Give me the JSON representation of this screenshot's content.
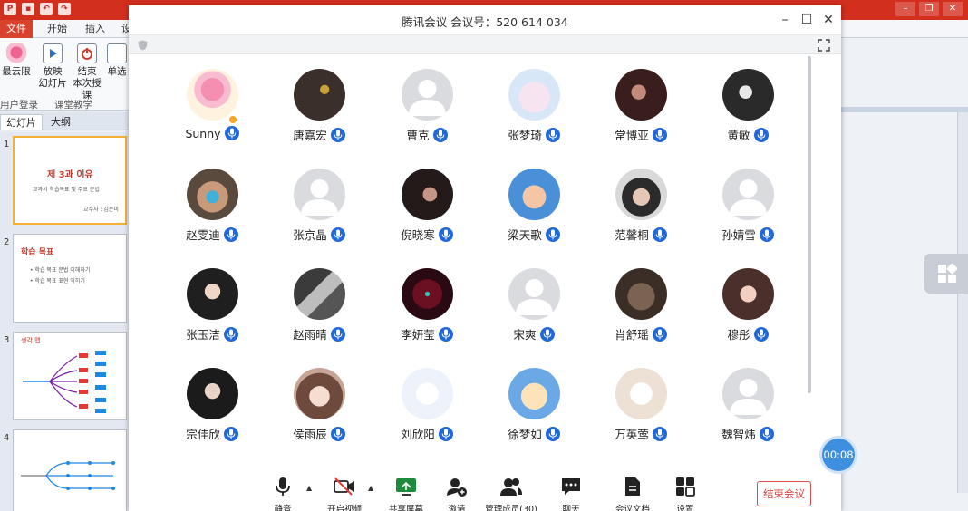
{
  "ppt": {
    "tabs": {
      "file": "文件",
      "home": "开始",
      "insert": "插入",
      "partial": "设"
    },
    "ribbon": {
      "btn1": "最云限",
      "btn2a": "放映",
      "btn2b": "幻灯片",
      "btn3a": "结束",
      "btn3b": "本次授课",
      "btn4": "单选",
      "group1": "用户登录",
      "group2": "课堂教学"
    },
    "side_tabs": {
      "slides": "幻灯片",
      "outline": "大纲"
    },
    "thumbs": [
      {
        "num": "1",
        "title": "제 3과 이유",
        "line1": "교과서 학습목표 및 주요 문법",
        "line2": "교수자 : 김은미"
      },
      {
        "num": "2",
        "title": "학습 목표",
        "line1": "• 학습 목표 문법 이해하기",
        "line2": "• 학습 목표 표현 익히기"
      },
      {
        "num": "3",
        "title": "생각 맵",
        "line1": "",
        "line2": ""
      },
      {
        "num": "4",
        "title": "",
        "line1": "",
        "line2": ""
      }
    ]
  },
  "meeting": {
    "title": "腾讯会议 会议号：520 614 034",
    "controls": {
      "minimize": "✕",
      "maximize": "☐",
      "close": "✕"
    },
    "participants": [
      {
        "name": "Sunny",
        "avatar": "flower",
        "host": true
      },
      {
        "name": "唐嘉宏",
        "avatar": "dark-flower"
      },
      {
        "name": "曹克",
        "avatar": "placeholder"
      },
      {
        "name": "张梦琦",
        "avatar": "cartoon-girl"
      },
      {
        "name": "常博亚",
        "avatar": "dark-portrait"
      },
      {
        "name": "黄敏",
        "avatar": "bw-portrait"
      },
      {
        "name": "赵雯迪",
        "avatar": "masked-person"
      },
      {
        "name": "张京晶",
        "avatar": "placeholder"
      },
      {
        "name": "倪晓寒",
        "avatar": "dark-hair-woman"
      },
      {
        "name": "梁天歌",
        "avatar": "cartoon-rabbit"
      },
      {
        "name": "范馨桐",
        "avatar": "boy-portrait"
      },
      {
        "name": "孙婧雪",
        "avatar": "placeholder"
      },
      {
        "name": "张玉洁",
        "avatar": "girl-portrait"
      },
      {
        "name": "赵雨晴",
        "avatar": "bw-street"
      },
      {
        "name": "李妍莹",
        "avatar": "red-anime"
      },
      {
        "name": "宋爽",
        "avatar": "placeholder"
      },
      {
        "name": "肖舒瑶",
        "avatar": "bear"
      },
      {
        "name": "穆彤",
        "avatar": "girl-selfie"
      },
      {
        "name": "宗佳欣",
        "avatar": "girl-dark"
      },
      {
        "name": "侯雨辰",
        "avatar": "girl-smile"
      },
      {
        "name": "刘欣阳",
        "avatar": "sketch-boy"
      },
      {
        "name": "徐梦如",
        "avatar": "cartoon-bunny"
      },
      {
        "name": "万英莺",
        "avatar": "cat-sketch"
      },
      {
        "name": "魏智炜",
        "avatar": "placeholder"
      }
    ],
    "toolbar": {
      "mute": "静音",
      "video": "开启视频",
      "share": "共享屏幕",
      "invite": "邀请",
      "members": "管理成员(30)",
      "chat": "聊天",
      "docs": "会议文档",
      "settings": "设置",
      "end": "结束会议"
    },
    "timer": "00:08",
    "colors": {
      "accent": "#2168d9",
      "end": "#d93b3b",
      "timer": "#3f8fe0"
    }
  }
}
